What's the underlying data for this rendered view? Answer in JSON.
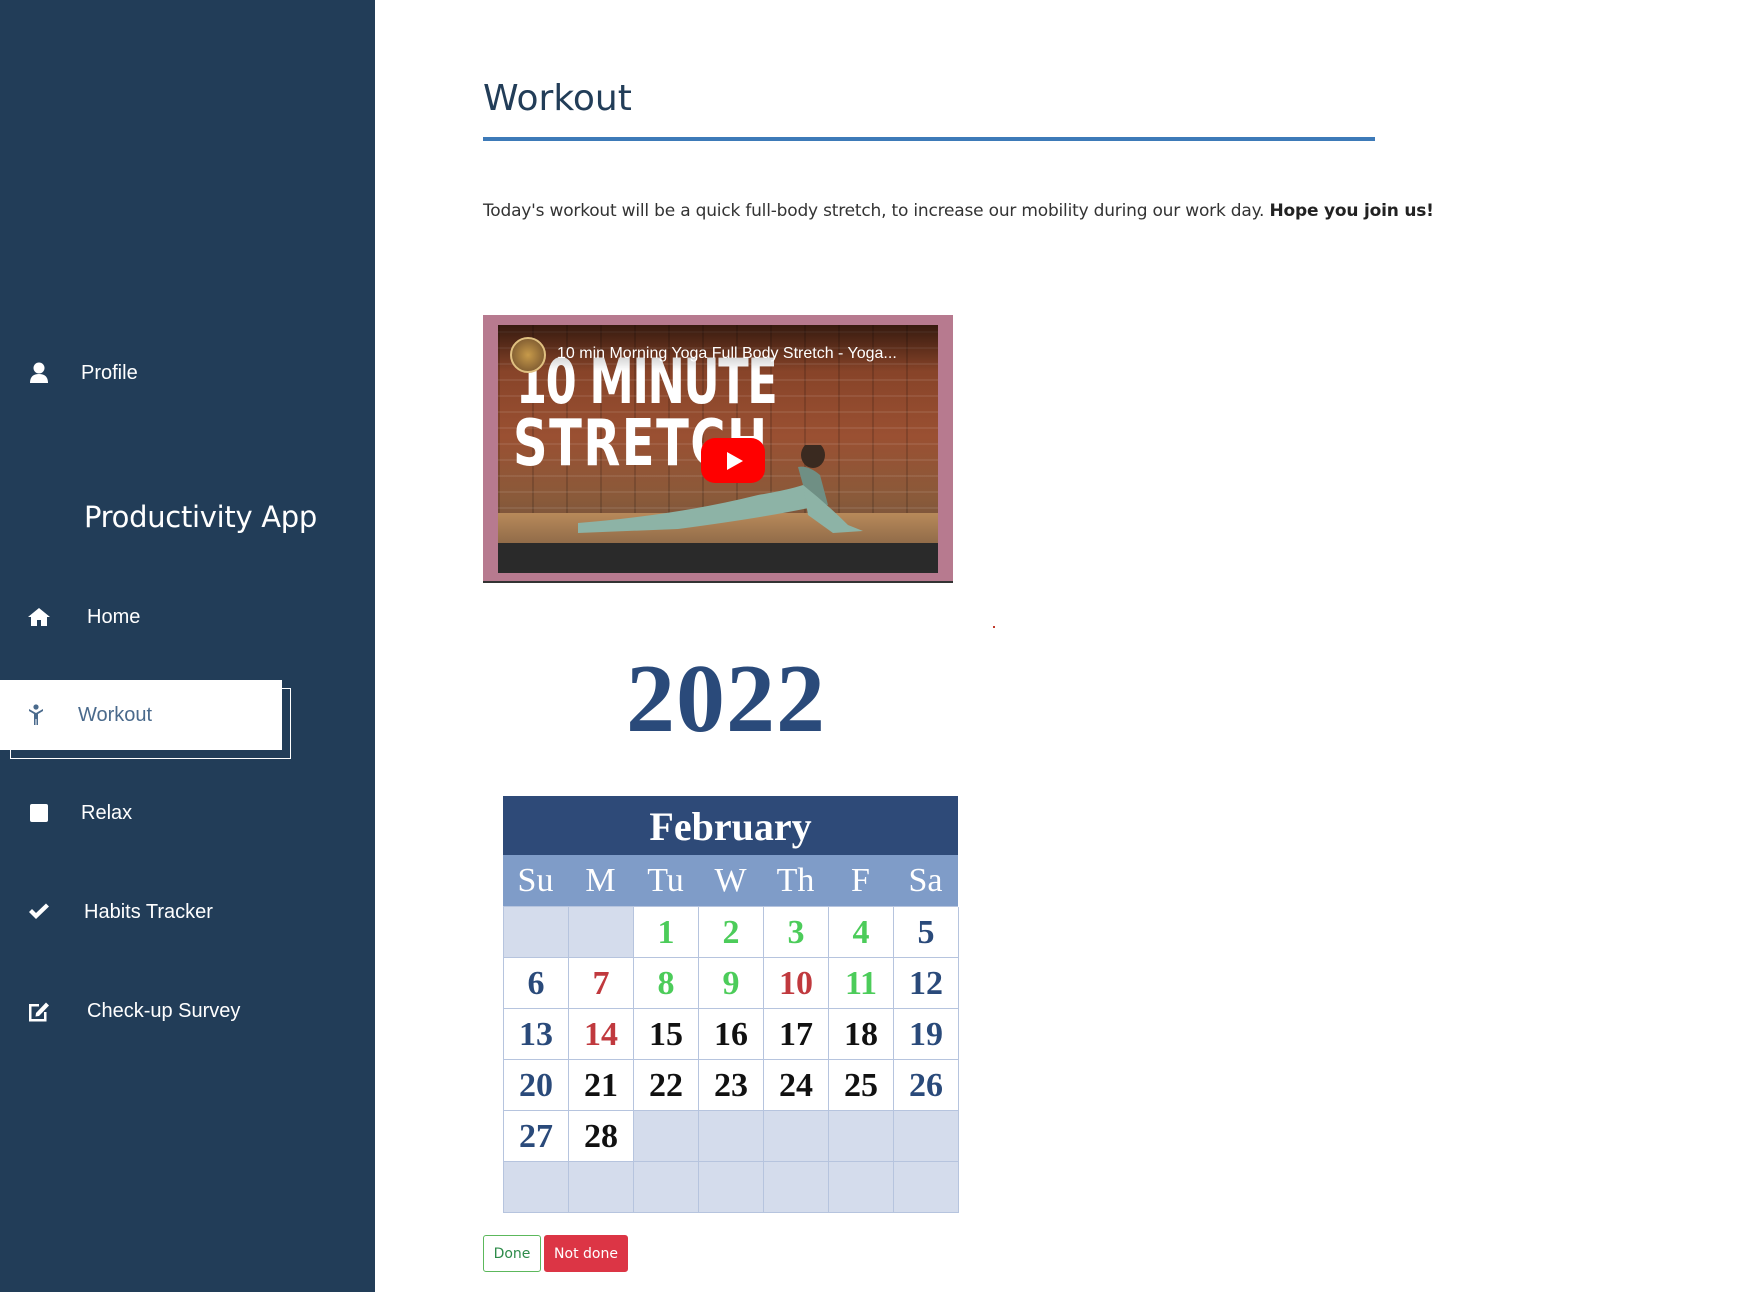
{
  "sidebar": {
    "app_title": "Productivity App",
    "items": [
      {
        "label": "Profile",
        "icon": "user-icon"
      },
      {
        "label": "Home",
        "icon": "home-icon"
      },
      {
        "label": "Workout",
        "icon": "person-icon",
        "active": true
      },
      {
        "label": "Relax",
        "icon": "square-icon"
      },
      {
        "label": "Habits Tracker",
        "icon": "check-icon"
      },
      {
        "label": "Check-up Survey",
        "icon": "edit-icon"
      }
    ]
  },
  "main": {
    "title": "Workout",
    "description": "Today's workout will be a quick full-body stretch, to increase our mobility during our work day.",
    "description_bold": "Hope you join us!",
    "video": {
      "title": "10 min Morning Yoga Full Body Stretch - Yoga...",
      "thumbnail_line1": "10 MINUTE",
      "thumbnail_line2": "STRETCH"
    },
    "calendar": {
      "year": "2022",
      "month": "February",
      "weekdays": [
        "Su",
        "M",
        "Tu",
        "W",
        "Th",
        "F",
        "Sa"
      ],
      "rows": [
        [
          "",
          "",
          "1",
          "2",
          "3",
          "4",
          "5"
        ],
        [
          "6",
          "7",
          "8",
          "9",
          "10",
          "11",
          "12"
        ],
        [
          "13",
          "14",
          "15",
          "16",
          "17",
          "18",
          "19"
        ],
        [
          "20",
          "21",
          "22",
          "23",
          "24",
          "25",
          "26"
        ],
        [
          "27",
          "28",
          "",
          "",
          "",
          "",
          ""
        ],
        [
          "",
          "",
          "",
          "",
          "",
          "",
          ""
        ]
      ],
      "colors": [
        [
          "",
          "",
          "green",
          "green",
          "green",
          "green",
          "blue"
        ],
        [
          "blue",
          "red",
          "green",
          "green",
          "red",
          "green",
          "blue"
        ],
        [
          "blue",
          "red",
          "black",
          "black",
          "black",
          "black",
          "blue"
        ],
        [
          "blue",
          "black",
          "black",
          "black",
          "black",
          "black",
          "blue"
        ],
        [
          "blue",
          "black",
          "",
          "",
          "",
          "",
          ""
        ],
        [
          "",
          "",
          "",
          "",
          "",
          "",
          ""
        ]
      ]
    },
    "buttons": {
      "done": "Done",
      "not_done": "Not done"
    }
  },
  "colors": {
    "sidebar_bg": "#223d58",
    "accent_rule": "#3d7ab8",
    "done_green": "#5cb85c",
    "not_done_red": "#dc3545"
  }
}
